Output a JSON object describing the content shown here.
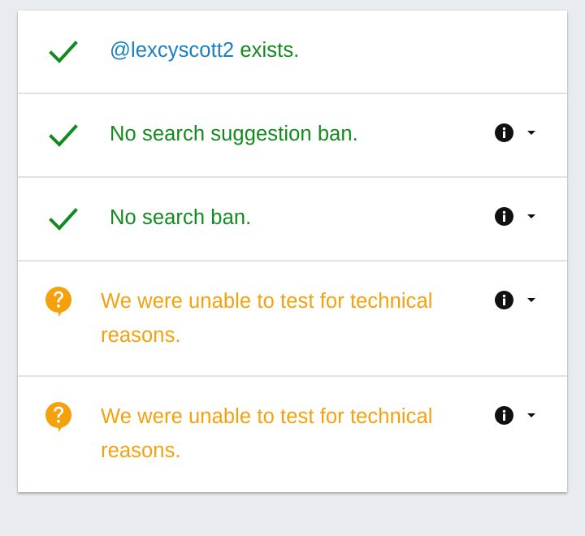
{
  "results": [
    {
      "status": "ok",
      "handle": "@lexcyscott2",
      "text": " exists.",
      "icon": "check-icon",
      "has_details": false
    },
    {
      "status": "ok",
      "text": "No search suggestion ban.",
      "icon": "check-icon",
      "has_details": true
    },
    {
      "status": "ok",
      "text": "No search ban.",
      "icon": "check-icon",
      "has_details": true
    },
    {
      "status": "unknown",
      "text": "We were unable to test for technical reasons.",
      "icon": "question-icon",
      "has_details": true
    },
    {
      "status": "unknown",
      "text": "We were unable to test for technical reasons.",
      "icon": "question-icon",
      "has_details": true
    }
  ],
  "colors": {
    "ok": "#138a1e",
    "unknown": "#f5a10c",
    "handle": "#1a7fbf",
    "icon_dark": "#111111",
    "background": "#e8ebef"
  },
  "icons": {
    "info": "info-icon",
    "dropdown": "chevron-down-icon"
  }
}
